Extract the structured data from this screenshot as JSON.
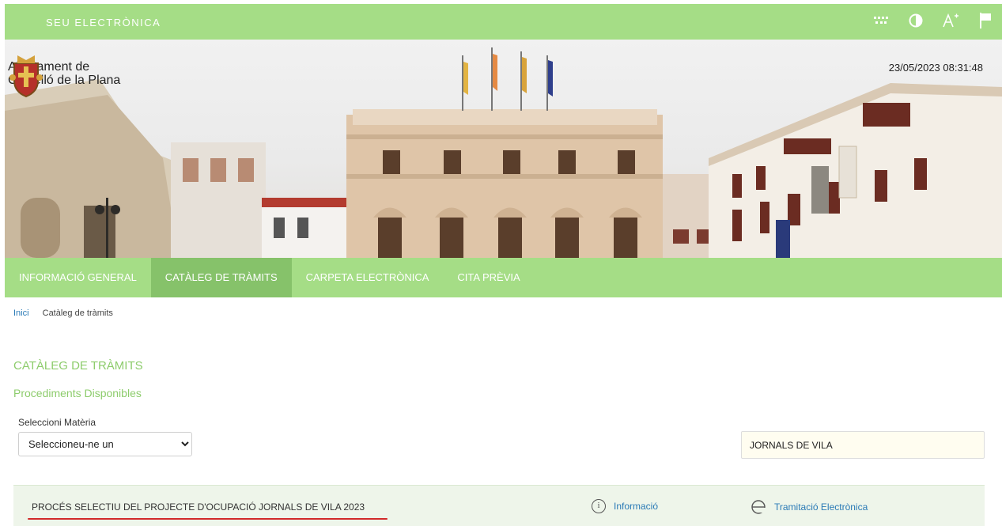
{
  "header": {
    "brand": "SEU ELECTRÒNICA",
    "tools": [
      {
        "icon": "grid-dots-icon"
      },
      {
        "icon": "contrast-icon"
      },
      {
        "icon": "font-size-icon"
      },
      {
        "icon": "flag-icon"
      }
    ]
  },
  "hero": {
    "logo_line1": "Ajuntament de",
    "logo_line2": "Castelló de la Plana",
    "datetime": "23/05/2023 08:31:48"
  },
  "nav": {
    "items": [
      {
        "label": "INFORMACIÓ GENERAL"
      },
      {
        "label": "CATÀLEG DE TRÀMITS",
        "active": true
      },
      {
        "label": "CARPETA ELECTRÒNICA"
      },
      {
        "label": "CITA PRÈVIA"
      }
    ]
  },
  "breadcrumb": {
    "home": "Inici",
    "current": "Catàleg de tràmits"
  },
  "page": {
    "title": "CATÀLEG DE TRÀMITS",
    "subtitle": "Procediments Disponibles",
    "select_label": "Seleccioni Matèria",
    "select_value": "Seleccioneu-ne un",
    "search_value": "JORNALS DE VILA"
  },
  "result": {
    "title": "PROCÉS SELECTIU DEL PROJECTE D'OCUPACIÓ JORNALS DE VILA 2023",
    "info_label": "Informació",
    "tram_label": "Tramitació Electrònica"
  },
  "colors": {
    "accent_green": "#a5dd86",
    "active_green": "#86c26a",
    "heading_green": "#8dcc6c",
    "link_blue": "#2a7ab6",
    "highlight_red": "#d12a2a"
  }
}
